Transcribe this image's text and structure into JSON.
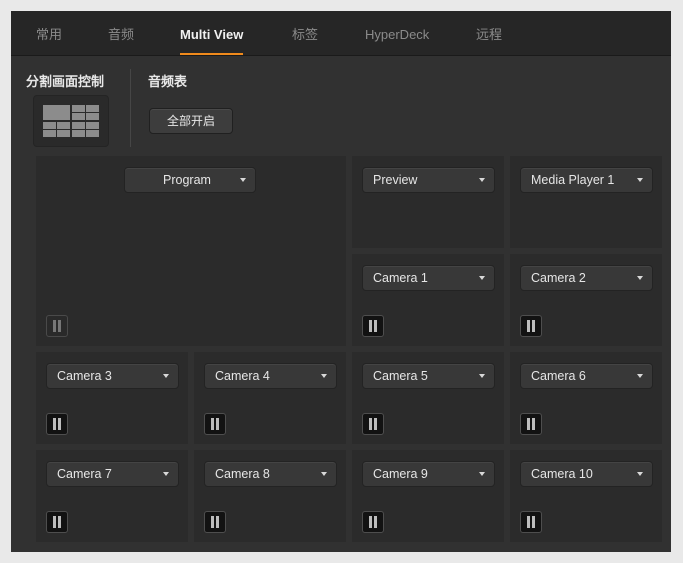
{
  "tabs": [
    {
      "label": "常用"
    },
    {
      "label": "音频"
    },
    {
      "label": "Multi View",
      "active": true
    },
    {
      "label": "标签"
    },
    {
      "label": "HyperDeck"
    },
    {
      "label": "远程"
    }
  ],
  "controls": {
    "layout_title": "分割画面控制",
    "meters_title": "音频表",
    "all_on_button": "全部开启"
  },
  "views": {
    "program": "Program",
    "preview": "Preview",
    "media_player_1": "Media Player 1",
    "camera_1": "Camera 1",
    "camera_2": "Camera 2",
    "camera_3": "Camera 3",
    "camera_4": "Camera 4",
    "camera_5": "Camera 5",
    "camera_6": "Camera 6",
    "camera_7": "Camera 7",
    "camera_8": "Camera 8",
    "camera_9": "Camera 9",
    "camera_10": "Camera 10"
  },
  "icons": {
    "dropdown": "chevron-down-icon",
    "meter": "audio-meter-icon",
    "layout": "layout-grid-icon"
  },
  "colors": {
    "accent": "#f08a1c",
    "panel_bg": "#313131",
    "tile_bg": "#2b2b2b"
  }
}
